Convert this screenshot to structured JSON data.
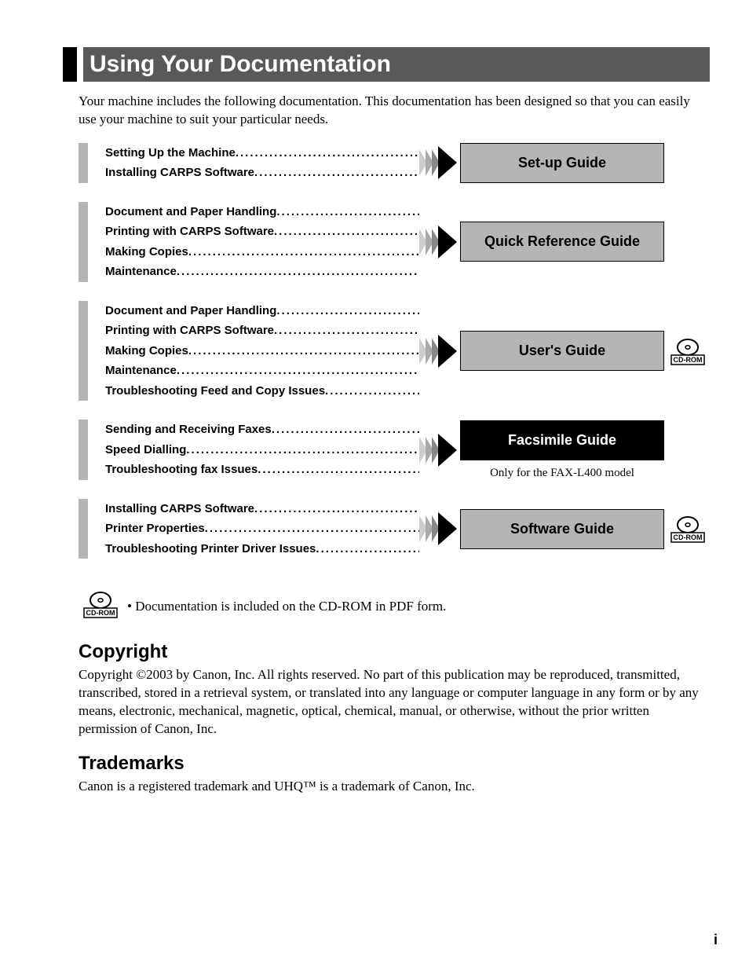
{
  "title": "Using Your Documentation",
  "intro": "Your machine includes the following documentation. This documentation has been designed so that you can easily use your machine to suit your particular needs.",
  "sections": [
    {
      "topics": [
        "Setting Up the Machine",
        "Installing CARPS Software"
      ],
      "guide": "Set-up Guide",
      "dark": false,
      "cd": false,
      "note": null
    },
    {
      "topics": [
        "Document and Paper Handling",
        "Printing with CARPS Software",
        "Making Copies",
        "Maintenance"
      ],
      "guide": "Quick Reference Guide",
      "dark": false,
      "cd": false,
      "note": null
    },
    {
      "topics": [
        "Document and Paper Handling",
        "Printing with CARPS Software",
        "Making Copies",
        "Maintenance",
        "Troubleshooting Feed and Copy Issues"
      ],
      "guide": "User's Guide",
      "dark": false,
      "cd": true,
      "note": null
    },
    {
      "topics": [
        "Sending and Receiving Faxes",
        "Speed Dialling",
        "Troubleshooting fax Issues"
      ],
      "guide": "Facsimile Guide",
      "dark": true,
      "cd": false,
      "note": "Only for the FAX-L400 model"
    },
    {
      "topics": [
        "Installing CARPS Software",
        "Printer Properties",
        "Troubleshooting Printer Driver Issues"
      ],
      "guide": "Software Guide",
      "dark": false,
      "cd": true,
      "note": null
    }
  ],
  "footer_bullet": "• Documentation is included on the CD-ROM in PDF form.",
  "copyright_heading": "Copyright",
  "copyright_text": "Copyright ©2003 by Canon, Inc. All rights reserved. No part of this publication may be reproduced, transmitted, transcribed, stored in a retrieval system, or translated into any language or computer language in any form or by any means, electronic, mechanical, magnetic, optical, chemical, manual, or otherwise, without the prior written permission of Canon, Inc.",
  "trademarks_heading": "Trademarks",
  "trademarks_text": "Canon is a registered trademark and UHQ™ is a trademark of Canon, Inc.",
  "cd_label": "CD-ROM",
  "page_number": "i"
}
